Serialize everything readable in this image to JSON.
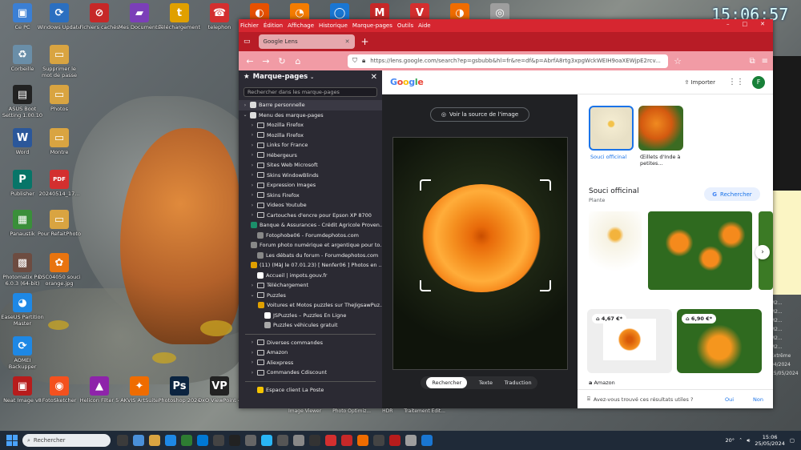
{
  "desktop": {
    "clock": "15:06:57",
    "icons": [
      {
        "label": "Ce PC",
        "symbol": "▣",
        "color": "#3b7fd4"
      },
      {
        "label": "Windows Update",
        "symbol": "⟳",
        "color": "#2b6fc0"
      },
      {
        "label": "Fichiers cachés",
        "symbol": "⊘",
        "color": "#c62828"
      },
      {
        "label": "Mes Documents",
        "symbol": "▰",
        "color": "#7b3fb8"
      },
      {
        "label": "Téléchargement",
        "symbol": "t",
        "color": "#e0a000"
      },
      {
        "label": "telephon",
        "symbol": "☎",
        "color": "#d32f2f"
      },
      {
        "label": "Corbeille",
        "symbol": "♻",
        "color": "#6a8ea8"
      },
      {
        "label": "Supprimer le mot de passe",
        "symbol": "▭",
        "color": "#d9a441"
      },
      {
        "label": "ASUS Boot Setting 1.00.10",
        "symbol": "▤",
        "color": "#222"
      },
      {
        "label": "Photos",
        "symbol": "▭",
        "color": "#d9a441"
      },
      {
        "label": "Word",
        "symbol": "W",
        "color": "#2b579a"
      },
      {
        "label": "Montre",
        "symbol": "▭",
        "color": "#d9a441"
      },
      {
        "label": "Publisher",
        "symbol": "P",
        "color": "#077568"
      },
      {
        "label": "20240514_17...",
        "symbol": "PDF",
        "color": "#d32f2f"
      },
      {
        "label": "Panaustik",
        "symbol": "▦",
        "color": "#3a8f3a"
      },
      {
        "label": "Pour RefaitPhoto",
        "symbol": "▭",
        "color": "#d9a441"
      },
      {
        "label": "Photomatix Pro 6.0.3 (64-bit)",
        "symbol": "▩",
        "color": "#6d4c41"
      },
      {
        "label": "DSC04050 souci orange.jpg",
        "symbol": "✿",
        "color": "#e8740f"
      },
      {
        "label": "EaseUS Partition Master",
        "symbol": "◕",
        "color": "#1e88e5"
      },
      {
        "label": "AOMEI Backupper",
        "symbol": "⟳",
        "color": "#1e88e5"
      },
      {
        "label": "Neat Image v8",
        "symbol": "▣",
        "color": "#b71c1c"
      },
      {
        "label": "FotoSketcher",
        "symbol": "◉",
        "color": "#f4511e"
      },
      {
        "label": "Helicon Filter 5",
        "symbol": "▲",
        "color": "#8e24aa"
      },
      {
        "label": "AKVIS ArtSuite",
        "symbol": "✦",
        "color": "#ef6c00"
      },
      {
        "label": "Photoshop 2024",
        "symbol": "Ps",
        "color": "#0b2440"
      },
      {
        "label": "DxO ViewPoint 4",
        "symbol": "VP",
        "color": "#222"
      },
      {
        "label": "Firefox",
        "symbol": "◐",
        "color": "#e65100"
      },
      {
        "label": "Historique",
        "symbol": "◔",
        "color": "#f57c00"
      },
      {
        "label": "Opera",
        "symbol": "◯",
        "color": "#1976d2"
      },
      {
        "label": "Gmail",
        "symbol": "M",
        "color": "#c62828"
      },
      {
        "label": "Vivaldi",
        "symbol": "V",
        "color": "#d32f2f"
      },
      {
        "label": "Firefox",
        "symbol": "◑",
        "color": "#ef6c00"
      },
      {
        "label": "Safari",
        "symbol": "◎",
        "color": "#9e9e9e"
      }
    ],
    "right_list": [
      "M2...",
      "M2...",
      "M2...",
      "M2...",
      "M2...",
      "M2...",
      "Extrême",
      "04/2024",
      "25/05/2024"
    ],
    "below_window": [
      "Image Viewer",
      "Photo Optimiz...",
      "HDR",
      "Traitement Edit..."
    ]
  },
  "browser": {
    "menu": [
      "Fichier",
      "Édition",
      "Affichage",
      "Historique",
      "Marque-pages",
      "Outils",
      "Aide"
    ],
    "tab_title": "Google Lens",
    "url": "https://lens.google.com/search?ep=gsbubb&hl=fr&re=df&p=AbrfA8rtg3xpgWckWEIH9oaXEWjpE2rcv...",
    "sidebar": {
      "title": "Marque-pages",
      "search_placeholder": "Rechercher dans les marque-pages",
      "items": [
        {
          "label": "Barre personnelle",
          "kind": "page",
          "chev": "›",
          "depth": 0,
          "sel": true
        },
        {
          "label": "Menu des marque-pages",
          "kind": "page",
          "chev": "⌄",
          "depth": 0
        },
        {
          "label": "Mozilla Firefox",
          "kind": "folder",
          "chev": "›",
          "depth": 1
        },
        {
          "label": "Mozilla Firefox",
          "kind": "folder",
          "chev": "›",
          "depth": 1
        },
        {
          "label": "Links for France",
          "kind": "folder",
          "chev": "›",
          "depth": 1
        },
        {
          "label": "Hébergeurs",
          "kind": "folder",
          "chev": "›",
          "depth": 1
        },
        {
          "label": "Sites Web Microsoft",
          "kind": "folder",
          "chev": "›",
          "depth": 1
        },
        {
          "label": "Skins WindowBlinds",
          "kind": "folder",
          "chev": "›",
          "depth": 1
        },
        {
          "label": "Expression Images",
          "kind": "folder",
          "chev": "›",
          "depth": 1
        },
        {
          "label": "Skins Firefox",
          "kind": "folder",
          "chev": "›",
          "depth": 1
        },
        {
          "label": "Videos Youtube",
          "kind": "folder",
          "chev": "›",
          "depth": 1
        },
        {
          "label": "Cartouches d'encre pour Epson XP 8700",
          "kind": "folder",
          "chev": "›",
          "depth": 1
        },
        {
          "label": "Banque & Assurances - Crédit Agricole Proven...",
          "kind": "page",
          "chev": "",
          "depth": 1,
          "color": "#1b8f6a"
        },
        {
          "label": "Fotophobe06 - Forumdephotos.com",
          "kind": "page",
          "chev": "",
          "depth": 1,
          "color": "#888"
        },
        {
          "label": "Forum photo numérique et argentique pour to...",
          "kind": "page",
          "chev": "",
          "depth": 1,
          "color": "#888"
        },
        {
          "label": "Les débats du forum - Forumdephotos.com",
          "kind": "page",
          "chev": "",
          "depth": 1,
          "color": "#888"
        },
        {
          "label": "(11) (MàJ le 07.01.23) [ Nenfer06 ] Photos en ...",
          "kind": "page",
          "chev": "",
          "depth": 1,
          "color": "#e0a000"
        },
        {
          "label": "Accueil | impots.gouv.fr",
          "kind": "page",
          "chev": "",
          "depth": 1,
          "color": "#fff"
        },
        {
          "label": "Téléchargement",
          "kind": "folder",
          "chev": "›",
          "depth": 1
        },
        {
          "label": "Puzzles",
          "kind": "folder",
          "chev": "⌄",
          "depth": 1
        },
        {
          "label": "Voitures et Motos puzzles sur TheJigsawPuz...",
          "kind": "page",
          "chev": "",
          "depth": 2,
          "color": "#e0a000"
        },
        {
          "label": "JSPuzzles – Puzzles En Ligne",
          "kind": "page",
          "chev": "",
          "depth": 2,
          "color": "#fff"
        },
        {
          "label": "Puzzles véhicules gratuit",
          "kind": "page",
          "chev": "",
          "depth": 2,
          "color": "#aaa"
        },
        {
          "label": "",
          "kind": "sep"
        },
        {
          "label": "Diverses commandes",
          "kind": "folder",
          "chev": "›",
          "depth": 1
        },
        {
          "label": "Amazon",
          "kind": "folder",
          "chev": "›",
          "depth": 1
        },
        {
          "label": "Aliexpress",
          "kind": "folder",
          "chev": "›",
          "depth": 1
        },
        {
          "label": "Commandes Cdiscount",
          "kind": "folder",
          "chev": "›",
          "depth": 1
        },
        {
          "label": "",
          "kind": "sep"
        },
        {
          "label": "Espace client La Poste",
          "kind": "page",
          "chev": "",
          "depth": 1,
          "color": "#f5c400"
        }
      ]
    }
  },
  "lens": {
    "importer": "Importer",
    "avatar": "F",
    "source_button": "Voir la source de l'image",
    "modes": [
      "Rechercher",
      "Texte",
      "Traduction"
    ],
    "chips": [
      {
        "label": "Souci officinal"
      },
      {
        "label": "Œillets d'Inde à petites..."
      }
    ],
    "knowledge_title": "Souci officinal",
    "knowledge_sub": "Plante",
    "search_button": "Rechercher",
    "products": [
      {
        "price": "4,67 €*"
      },
      {
        "price": "6,90 €*"
      }
    ],
    "store": "Amazon",
    "feedback": "Avez-vous trouvé ces résultats utiles ?",
    "yes": "Oui",
    "no": "Non"
  },
  "taskbar": {
    "search_placeholder": "Rechercher",
    "weather": "20°",
    "time": "15:06",
    "date": "25/05/2024"
  }
}
